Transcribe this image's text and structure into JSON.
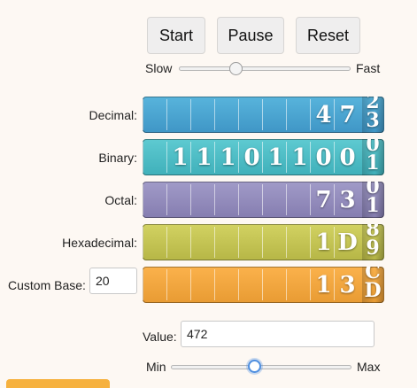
{
  "controls": {
    "start_label": "Start",
    "pause_label": "Pause",
    "reset_label": "Reset",
    "speed_min_label": "Slow",
    "speed_max_label": "Fast",
    "speed_level": 0.33
  },
  "counters": [
    {
      "label": "Decimal:",
      "digits": [
        "4",
        "7"
      ],
      "roll": [
        "2",
        "3"
      ],
      "color_top": "#58b4dc",
      "color_bottom": "#3f96c6"
    },
    {
      "label": "Binary:",
      "digits": [
        "1",
        "1",
        "1",
        "0",
        "1",
        "1",
        "0",
        "0"
      ],
      "roll": [
        "0",
        "1"
      ],
      "color_top": "#5ecad1",
      "color_bottom": "#3fb0ba"
    },
    {
      "label": "Octal:",
      "digits": [
        "7",
        "3"
      ],
      "roll": [
        "0",
        "1"
      ],
      "color_top": "#a19bc8",
      "color_bottom": "#857db0"
    },
    {
      "label": "Hexadecimal:",
      "digits": [
        "1",
        "D"
      ],
      "roll": [
        "8",
        "9"
      ],
      "color_top": "#d2d262",
      "color_bottom": "#b6b646"
    },
    {
      "label": "Custom Base:",
      "digits": [
        "1",
        "3"
      ],
      "roll": [
        "C",
        "D"
      ],
      "color_top": "#fbb24c",
      "color_bottom": "#e89b33"
    }
  ],
  "custom_base": {
    "value": "20"
  },
  "value_field": {
    "label": "Value:",
    "value": "472"
  },
  "value_slider": {
    "min_label": "Min",
    "max_label": "Max",
    "level": 0.47
  }
}
